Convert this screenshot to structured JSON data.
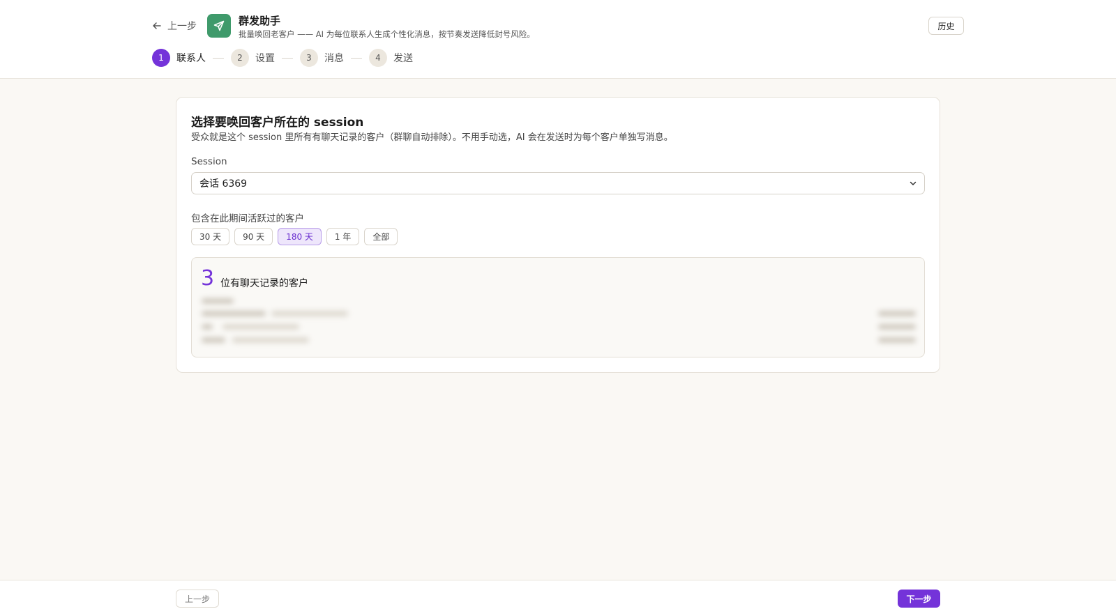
{
  "header": {
    "back_label": "上一步",
    "app_title": "群发助手",
    "app_subtitle": "批量唤回老客户 —— AI 为每位联系人生成个性化消息，按节奏发送降低封号风险。",
    "history_label": "历史",
    "icon": "send-icon",
    "accent_color": "#3f9a6b"
  },
  "steps": [
    {
      "num": "1",
      "label": "联系人",
      "active": true
    },
    {
      "num": "2",
      "label": "设置",
      "active": false
    },
    {
      "num": "3",
      "label": "消息",
      "active": false
    },
    {
      "num": "4",
      "label": "发送",
      "active": false
    }
  ],
  "card": {
    "title": "选择要唤回客户所在的 session",
    "description": "受众就是这个 session 里所有有聊天记录的客户（群聊自动排除）。不用手动选，AI 会在发送时为每个客户单独写消息。",
    "session_label": "Session",
    "session_value": "会话 6369",
    "range_label": "包含在此期间活跃过的客户",
    "range_options": [
      "30 天",
      "90 天",
      "180 天",
      "1 年",
      "全部"
    ],
    "range_selected": "180 天",
    "count": "3",
    "count_text": "位有聊天记录的客户"
  },
  "footer": {
    "prev_label": "上一步",
    "next_label": "下一步"
  },
  "colors": {
    "primary": "#7433d9",
    "background": "#faf8f4"
  }
}
